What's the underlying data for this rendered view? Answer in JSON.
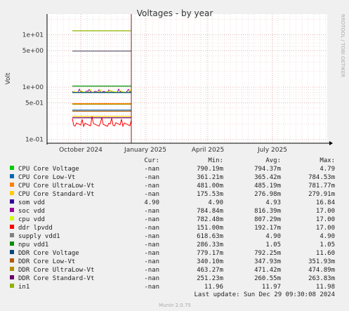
{
  "chart_data": {
    "type": "line",
    "title": "Voltages - by year",
    "ylabel": "Volt",
    "y_scale": "log",
    "ylim": [
      0.085,
      25
    ],
    "y_ticks": [
      {
        "value": 10,
        "label": "1e+01"
      },
      {
        "value": 5,
        "label": "5e+00"
      },
      {
        "value": 1,
        "label": "1e+00"
      },
      {
        "value": 0.5,
        "label": "5e-01"
      },
      {
        "value": 0.1,
        "label": "1e-01"
      }
    ],
    "x_ticks": [
      "October 2024",
      "January 2025",
      "April 2025",
      "July 2025"
    ],
    "side_label": "RRDTOOL / TOBI OETIKER",
    "columns": {
      "cur": "Cur:",
      "min": "Min:",
      "avg": "Avg:",
      "max": "Max:"
    },
    "series": [
      {
        "name": "CPU Core Voltage",
        "color": "#00cc00",
        "cur": "-nan",
        "min": "790.19m",
        "avg": "794.37m",
        "max": "4.79"
      },
      {
        "name": "CPU Core Low-Vt",
        "color": "#0066b3",
        "cur": "-nan",
        "min": "361.21m",
        "avg": "365.42m",
        "max": "784.53m"
      },
      {
        "name": "CPU Core UltraLow-Vt",
        "color": "#ff8000",
        "cur": "-nan",
        "min": "481.00m",
        "avg": "485.19m",
        "max": "781.77m"
      },
      {
        "name": "CPU Core Standard-Vt",
        "color": "#ffcc00",
        "cur": "-nan",
        "min": "175.53m",
        "avg": "276.98m",
        "max": "279.91m"
      },
      {
        "name": "som vdd",
        "color": "#330099",
        "cur": "4.90",
        "min": "4.90",
        "avg": "4.93",
        "max": "16.84"
      },
      {
        "name": "soc vdd",
        "color": "#990099",
        "cur": "-nan",
        "min": "784.84m",
        "avg": "816.39m",
        "max": "17.00"
      },
      {
        "name": "cpu vdd",
        "color": "#ccff00",
        "cur": "-nan",
        "min": "782.48m",
        "avg": "807.29m",
        "max": "17.00"
      },
      {
        "name": "ddr lpvdd",
        "color": "#ff0000",
        "cur": "-nan",
        "min": "151.00m",
        "avg": "192.17m",
        "max": "17.00"
      },
      {
        "name": "supply vdd1",
        "color": "#808080",
        "cur": "-nan",
        "min": "618.63m",
        "avg": "4.90",
        "max": "4.90"
      },
      {
        "name": "npu vdd1",
        "color": "#008f00",
        "cur": "-nan",
        "min": "286.33m",
        "avg": "1.05",
        "max": "1.05"
      },
      {
        "name": "DDR Core Voltage",
        "color": "#00487d",
        "cur": "-nan",
        "min": "779.17m",
        "avg": "792.25m",
        "max": "11.60"
      },
      {
        "name": "DDR Core Low-Vt",
        "color": "#b35a00",
        "cur": "-nan",
        "min": "340.10m",
        "avg": "347.93m",
        "max": "351.93m"
      },
      {
        "name": "DDR Core UltraLow-Vt",
        "color": "#b38f00",
        "cur": "-nan",
        "min": "463.27m",
        "avg": "471.42m",
        "max": "474.89m"
      },
      {
        "name": "DDR Core Standard-Vt",
        "color": "#6b006b",
        "cur": "-nan",
        "min": "251.23m",
        "avg": "260.55m",
        "max": "263.83m"
      },
      {
        "name": "in1",
        "color": "#8fb300",
        "cur": "-nan",
        "min": "11.96",
        "avg": "11.97",
        "max": "11.98"
      }
    ],
    "last_update": "Last update: Sun Dec 29 09:30:08 2024",
    "footer": "Munin 2.0.75"
  }
}
